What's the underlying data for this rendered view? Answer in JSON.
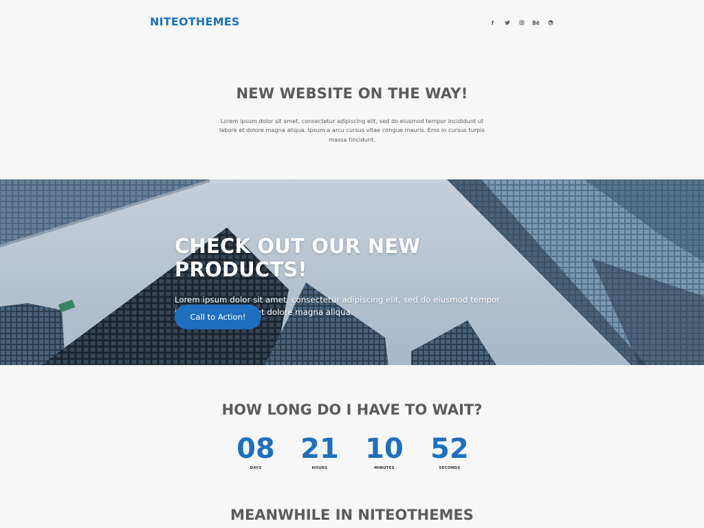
{
  "header": {
    "logo": "NITEOTHEMES",
    "socials": [
      {
        "icon": "facebook-icon",
        "glyph": "f"
      },
      {
        "icon": "twitter-icon",
        "glyph": ""
      },
      {
        "icon": "instagram-icon",
        "glyph": ""
      },
      {
        "icon": "behance-icon",
        "glyph": "Bē"
      },
      {
        "icon": "dribbble-icon",
        "glyph": ""
      }
    ]
  },
  "intro": {
    "title": "NEW WEBSITE ON THE WAY!",
    "text": "Lorem ipsum dolor sit amet, consectetur adipiscing elit, sed do eiusmod tempor incididunt ut labore et dolore magna aliqua. Ipsum a arcu cursus vitae congue mauris. Eros in cursus turpis massa tincidunt."
  },
  "hero": {
    "title": "CHECK OUT OUR NEW PRODUCTS!",
    "text": "Lorem ipsum dolor sit amet, consectetur adipiscing elit, sed do eiusmod tempor incididunt ut labore et dolore magna aliqua.",
    "cta_label": "Call to Action!"
  },
  "countdown": {
    "title": "HOW LONG DO I HAVE TO WAIT?",
    "days": "08",
    "days_label": "DAYS",
    "hours": "21",
    "hours_label": "HOURS",
    "minutes": "10",
    "minutes_label": "MINUTES",
    "seconds": "52",
    "seconds_label": "SECONDS"
  },
  "meanwhile": {
    "title": "MEANWHILE IN NITEOTHEMES"
  },
  "colors": {
    "accent": "#1e6fc0",
    "text": "#5b5b5b",
    "background": "#f7f7f8"
  }
}
